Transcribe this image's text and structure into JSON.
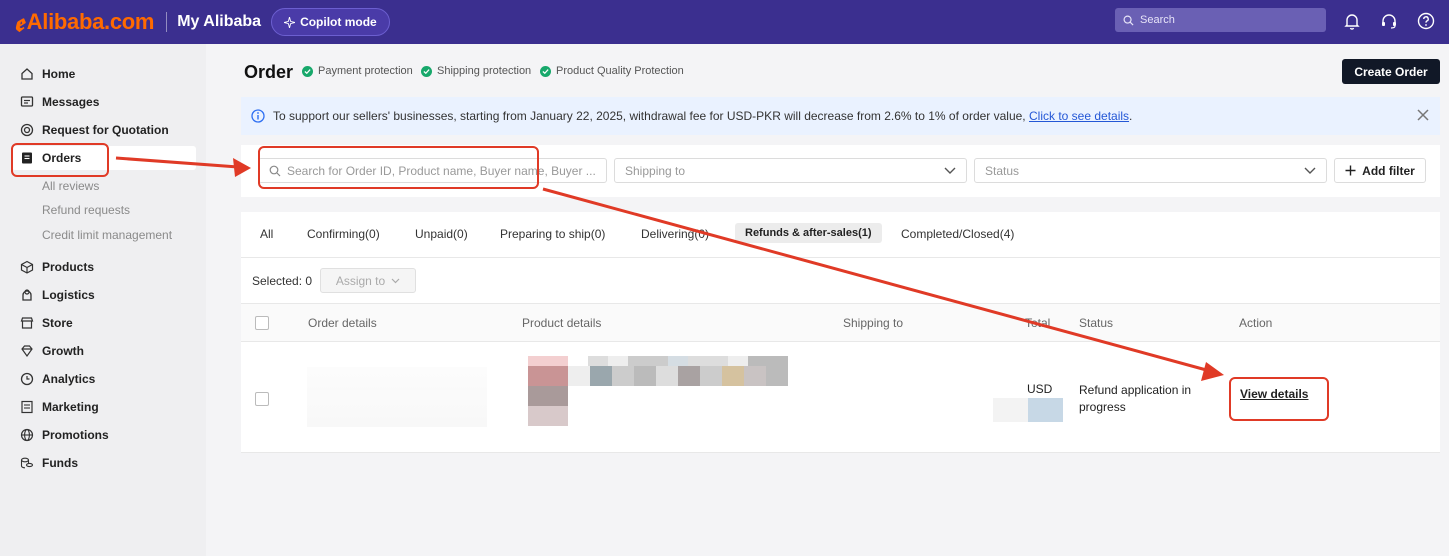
{
  "topbar": {
    "brand": "Alibaba.com",
    "brand_mark": "ꬲ",
    "product": "My Alibaba",
    "copilot": "Copilot mode",
    "search_placeholder": "Search",
    "icons": [
      "bell-icon",
      "headset-icon",
      "help-icon"
    ]
  },
  "sidebar": {
    "items": [
      {
        "label": "Home",
        "icon": "home-icon"
      },
      {
        "label": "Messages",
        "icon": "message-icon"
      },
      {
        "label": "Request for Quotation",
        "icon": "rfq-icon"
      },
      {
        "label": "Orders",
        "icon": "orders-icon",
        "active": true
      },
      {
        "label": "Products",
        "icon": "box-icon"
      },
      {
        "label": "Logistics",
        "icon": "logistics-icon"
      },
      {
        "label": "Store",
        "icon": "store-icon"
      },
      {
        "label": "Growth",
        "icon": "diamond-icon"
      },
      {
        "label": "Analytics",
        "icon": "clock-icon"
      },
      {
        "label": "Marketing",
        "icon": "marketing-icon"
      },
      {
        "label": "Promotions",
        "icon": "globe-icon"
      },
      {
        "label": "Funds",
        "icon": "coins-icon"
      }
    ],
    "order_sub": [
      "All reviews",
      "Refund requests",
      "Credit limit management"
    ]
  },
  "page": {
    "title": "Order",
    "protections": [
      "Payment protection",
      "Shipping protection",
      "Product Quality Protection"
    ],
    "create_button": "Create Order"
  },
  "notice": {
    "text": "To support our sellers' businesses, starting from January 22, 2025, withdrawal fee for USD-PKR will decrease from 2.6% to 1% of order value,",
    "link": "Click to see details",
    "trailing": "."
  },
  "filters": {
    "search_placeholder": "Search for Order ID, Product name, Buyer name, Buyer ...",
    "shipping_placeholder": "Shipping to",
    "status_placeholder": "Status",
    "add_filter": "Add filter"
  },
  "tabs": [
    "All",
    "Confirming(0)",
    "Unpaid(0)",
    "Preparing to ship(0)",
    "Delivering(0)",
    "Refunds & after-sales(1)",
    "Completed/Closed(4)"
  ],
  "selected_tab": "Refunds & after-sales(1)",
  "selection": {
    "label": "Selected: 0",
    "assign": "Assign to"
  },
  "table": {
    "headers": [
      "Order details",
      "Product details",
      "Shipping to",
      "Total",
      "Status",
      "Action"
    ],
    "rows": [
      {
        "currency": "USD",
        "status": "Refund application in progress",
        "action": "View details"
      }
    ]
  },
  "colors": {
    "topbar": "#3b2f8f",
    "brand": "#ff6a00",
    "annotation": "#e03a26",
    "check": "#17a86b",
    "link": "#2457d6"
  }
}
